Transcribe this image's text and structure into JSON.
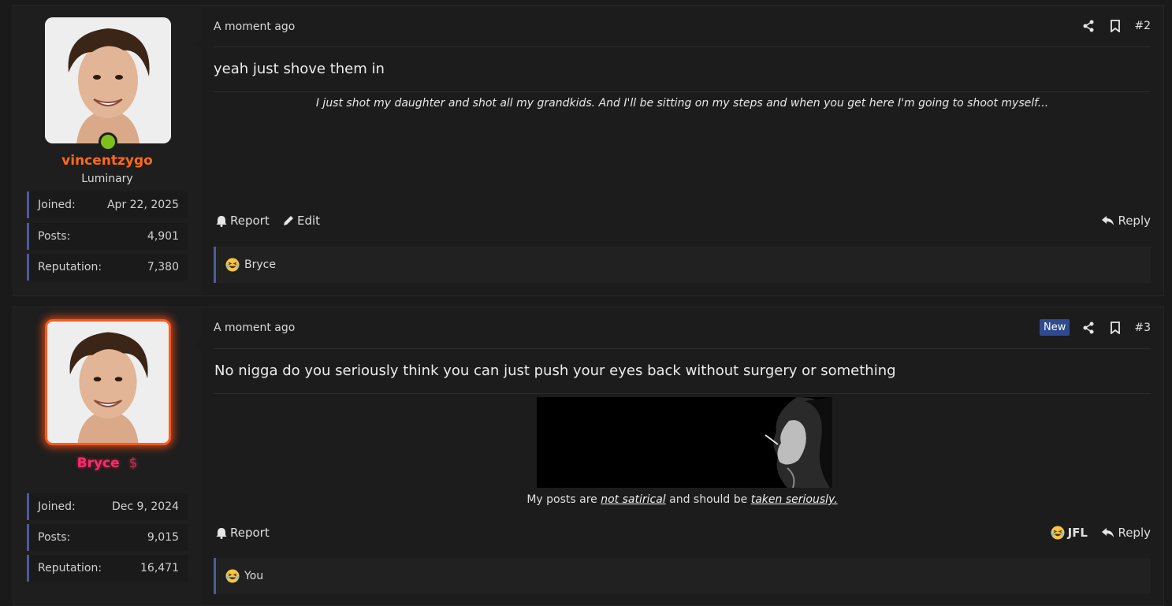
{
  "posts": [
    {
      "user": {
        "name": "vincentzygo",
        "title": "Luminary",
        "online": true,
        "stats": [
          {
            "label": "Joined:",
            "value": "Apr 22, 2025"
          },
          {
            "label": "Posts:",
            "value": "4,901"
          },
          {
            "label": "Reputation:",
            "value": "7,380"
          }
        ]
      },
      "timestamp": "A moment ago",
      "number": "#2",
      "body": "yeah just shove them in",
      "signature_quote": "I just shot my daughter and shot all my grandkids. And I'll be sitting on my steps and when you get here I'm going to shoot myself...",
      "actions": {
        "report": "Report",
        "edit": "Edit",
        "reply": "Reply"
      },
      "reactions": {
        "user": "Bryce"
      }
    },
    {
      "user": {
        "name": "Bryce",
        "name_symbol": "$",
        "stats": [
          {
            "label": "Joined:",
            "value": "Dec 9, 2024"
          },
          {
            "label": "Posts:",
            "value": "9,015"
          },
          {
            "label": "Reputation:",
            "value": "16,471"
          }
        ]
      },
      "timestamp": "A moment ago",
      "badge": "New",
      "number": "#3",
      "body": "No nigga do you seriously think you can just push your eyes back without surgery or something",
      "signature": {
        "prefix": "My posts are ",
        "link1": "not satirical",
        "middle": " and should be ",
        "link2": "taken seriously."
      },
      "actions": {
        "report": "Report",
        "jfl": "JFL",
        "reply": "Reply"
      },
      "reactions": {
        "user": "You"
      }
    }
  ],
  "icons": [
    "share-icon",
    "bookmark-icon",
    "bell-icon",
    "pencil-icon",
    "reply-icon",
    "laughing-emoji-icon"
  ],
  "colors": {
    "accent": "#4a5c9a",
    "username_orange": "#ff6a1a",
    "username_pink": "#ff2a6a",
    "online": "#7fbf1a",
    "new_badge": "#2f4a8f"
  }
}
